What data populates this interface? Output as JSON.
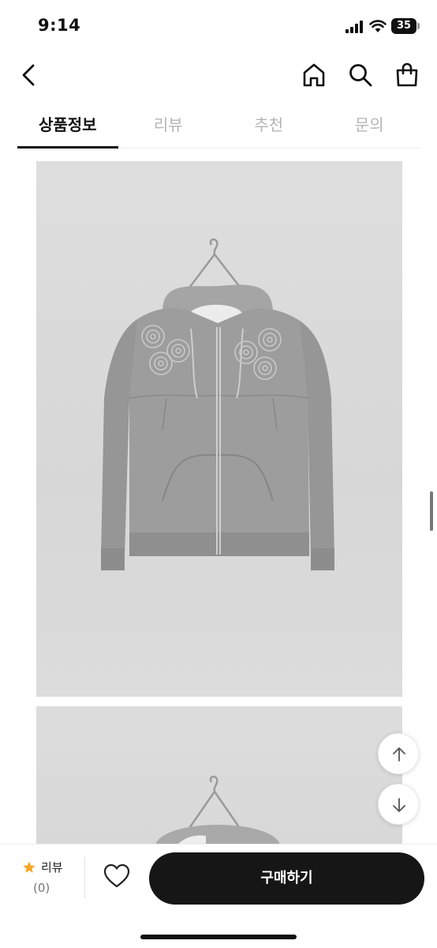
{
  "status_bar": {
    "time": "9:14",
    "battery": "35"
  },
  "nav": {
    "back_icon": "chevron-left-icon",
    "home_icon": "home-icon",
    "search_icon": "search-icon",
    "bag_icon": "shopping-bag-icon"
  },
  "tabs": [
    {
      "label": "상품정보",
      "active": true
    },
    {
      "label": "리뷰",
      "active": false
    },
    {
      "label": "추천",
      "active": false
    },
    {
      "label": "문의",
      "active": false
    }
  ],
  "floating_buttons": {
    "up_icon": "arrow-up-icon",
    "down_icon": "arrow-down-icon"
  },
  "bottom_bar": {
    "review_label": "리뷰",
    "review_count": "(0)",
    "star_color": "#f5a623",
    "buy_label": "구매하기",
    "buy_color": "#161616"
  }
}
